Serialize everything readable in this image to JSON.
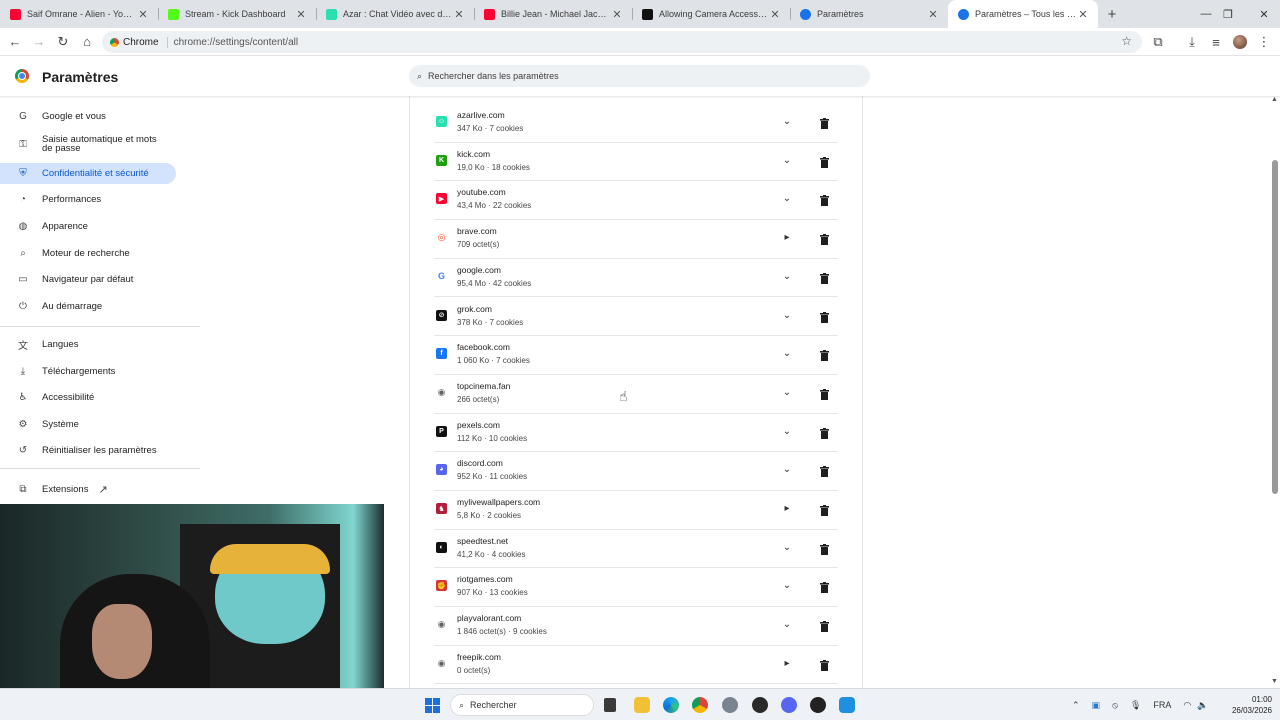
{
  "browser": {
    "tabs": [
      {
        "title": "Saif Omrane - Alien - YouTube",
        "favicon": "youtube-icon",
        "color": "#ff0033",
        "active": false
      },
      {
        "title": "Stream - Kick Dashboard",
        "favicon": "kick-icon",
        "color": "#53fc18",
        "active": false
      },
      {
        "title": "Azar : Chat Vidéo avec de nouv",
        "favicon": "azar-icon",
        "color": "#2be0b0",
        "active": false
      },
      {
        "title": "Billie Jean - Michael Jackson (L",
        "favicon": "youtube-icon",
        "color": "#ff0033",
        "active": false
      },
      {
        "title": "Allowing Camera Access on De",
        "favicon": "openai-icon",
        "color": "#111111",
        "active": false
      },
      {
        "title": "Paramètres",
        "favicon": "gear-icon",
        "color": "#1a73e8",
        "active": false
      },
      {
        "title": "Paramètres – Tous les sites",
        "favicon": "gear-icon",
        "color": "#1a73e8",
        "active": true
      }
    ],
    "omnibox": {
      "chip": "Chrome",
      "url": "chrome://settings/content/all"
    }
  },
  "settings": {
    "title": "Paramètres",
    "search_placeholder": "Rechercher dans les paramètres",
    "nav": [
      {
        "label": "Google et vous",
        "icon": "google-icon",
        "glyph": "G",
        "active": false
      },
      {
        "label": "Saisie automatique et mots",
        "label2": "de passe",
        "icon": "key-icon",
        "glyph": "⚿",
        "active": false
      },
      {
        "label": "Confidentialité et sécurité",
        "icon": "shield-icon",
        "glyph": "⛨",
        "active": true
      },
      {
        "label": "Performances",
        "icon": "speedometer-icon",
        "glyph": "◔",
        "active": false
      },
      {
        "label": "Apparence",
        "icon": "palette-icon",
        "glyph": "◍",
        "active": false
      },
      {
        "label": "Moteur de recherche",
        "icon": "search-icon",
        "glyph": "⌕",
        "active": false
      },
      {
        "label": "Navigateur par défaut",
        "icon": "browser-window-icon",
        "glyph": "▭",
        "active": false
      },
      {
        "label": "Au démarrage",
        "icon": "power-icon",
        "glyph": "⏻",
        "active": false
      },
      {
        "label": "Langues",
        "icon": "translate-icon",
        "glyph": "文",
        "active": false
      },
      {
        "label": "Téléchargements",
        "icon": "download-icon",
        "glyph": "⤓",
        "active": false
      },
      {
        "label": "Accessibilité",
        "icon": "accessibility-icon",
        "glyph": "♿",
        "active": false
      },
      {
        "label": "Système",
        "icon": "wrench-icon",
        "glyph": "⚙",
        "active": false
      },
      {
        "label": "Réinitialiser les paramètres",
        "icon": "reset-icon",
        "glyph": "↺",
        "active": false
      },
      {
        "label": "Extensions",
        "icon": "puzzle-icon",
        "glyph": "⧉",
        "active": false,
        "external": true
      }
    ],
    "sites": [
      {
        "domain": "azarlive.com",
        "info": "347 Ko · 7 cookies",
        "icon": "azar-icon",
        "color": "#2be0b0",
        "glyph": "☺",
        "expand": "chevron-down"
      },
      {
        "domain": "kick.com",
        "info": "19,0 Ko · 18 cookies",
        "icon": "kick-icon",
        "color": "#1fa00f",
        "glyph": "K",
        "expand": "chevron-down"
      },
      {
        "domain": "youtube.com",
        "info": "43,4 Mo · 22 cookies",
        "icon": "youtube-icon",
        "color": "#ff0033",
        "glyph": "▶",
        "expand": "chevron-down"
      },
      {
        "domain": "brave.com",
        "info": "709 octet(s)",
        "icon": "brave-icon",
        "color": "#fb542b",
        "glyph": "◎",
        "expand": "chevron-right"
      },
      {
        "domain": "google.com",
        "info": "95,4 Mo · 42 cookies",
        "icon": "google-icon",
        "color": "#4285f4",
        "glyph": "G",
        "expand": "chevron-down"
      },
      {
        "domain": "grok.com",
        "info": "378 Ko · 7 cookies",
        "icon": "grok-icon",
        "color": "#111111",
        "glyph": "⊘",
        "expand": "chevron-down"
      },
      {
        "domain": "facebook.com",
        "info": "1 060 Ko · 7 cookies",
        "icon": "facebook-icon",
        "color": "#1877f2",
        "glyph": "f",
        "expand": "chevron-down"
      },
      {
        "domain": "topcinema.fan",
        "info": "266 octet(s)",
        "icon": "globe-icon",
        "color": "#5f6368",
        "glyph": "◉",
        "expand": "chevron-down"
      },
      {
        "domain": "pexels.com",
        "info": "112 Ko · 10 cookies",
        "icon": "pexels-icon",
        "color": "#111111",
        "glyph": "P",
        "expand": "chevron-down"
      },
      {
        "domain": "discord.com",
        "info": "952 Ko · 11 cookies",
        "icon": "discord-icon",
        "color": "#5865f2",
        "glyph": "◕",
        "expand": "chevron-down"
      },
      {
        "domain": "mylivewallpapers.com",
        "info": "5,8 Ko · 2 cookies",
        "icon": "wallpaper-icon",
        "color": "#b71c3a",
        "glyph": "♞",
        "expand": "chevron-right"
      },
      {
        "domain": "speedtest.net",
        "info": "41,2 Ko · 4 cookies",
        "icon": "speedtest-icon",
        "color": "#111111",
        "glyph": "◐",
        "expand": "chevron-down"
      },
      {
        "domain": "riotgames.com",
        "info": "907 Ko · 13 cookies",
        "icon": "riot-icon",
        "color": "#d13639",
        "glyph": "✊",
        "expand": "chevron-down"
      },
      {
        "domain": "playvalorant.com",
        "info": "1 846 octet(s) · 9 cookies",
        "icon": "globe-icon",
        "color": "#5f6368",
        "glyph": "◉",
        "expand": "chevron-down"
      },
      {
        "domain": "freepik.com",
        "info": "0 octet(s)",
        "icon": "globe-icon",
        "color": "#5f6368",
        "glyph": "◉",
        "expand": "chevron-right"
      }
    ]
  },
  "taskbar": {
    "search_placeholder": "Rechercher",
    "language": "FRA",
    "time": "01:00",
    "date": "26/03/2026"
  }
}
